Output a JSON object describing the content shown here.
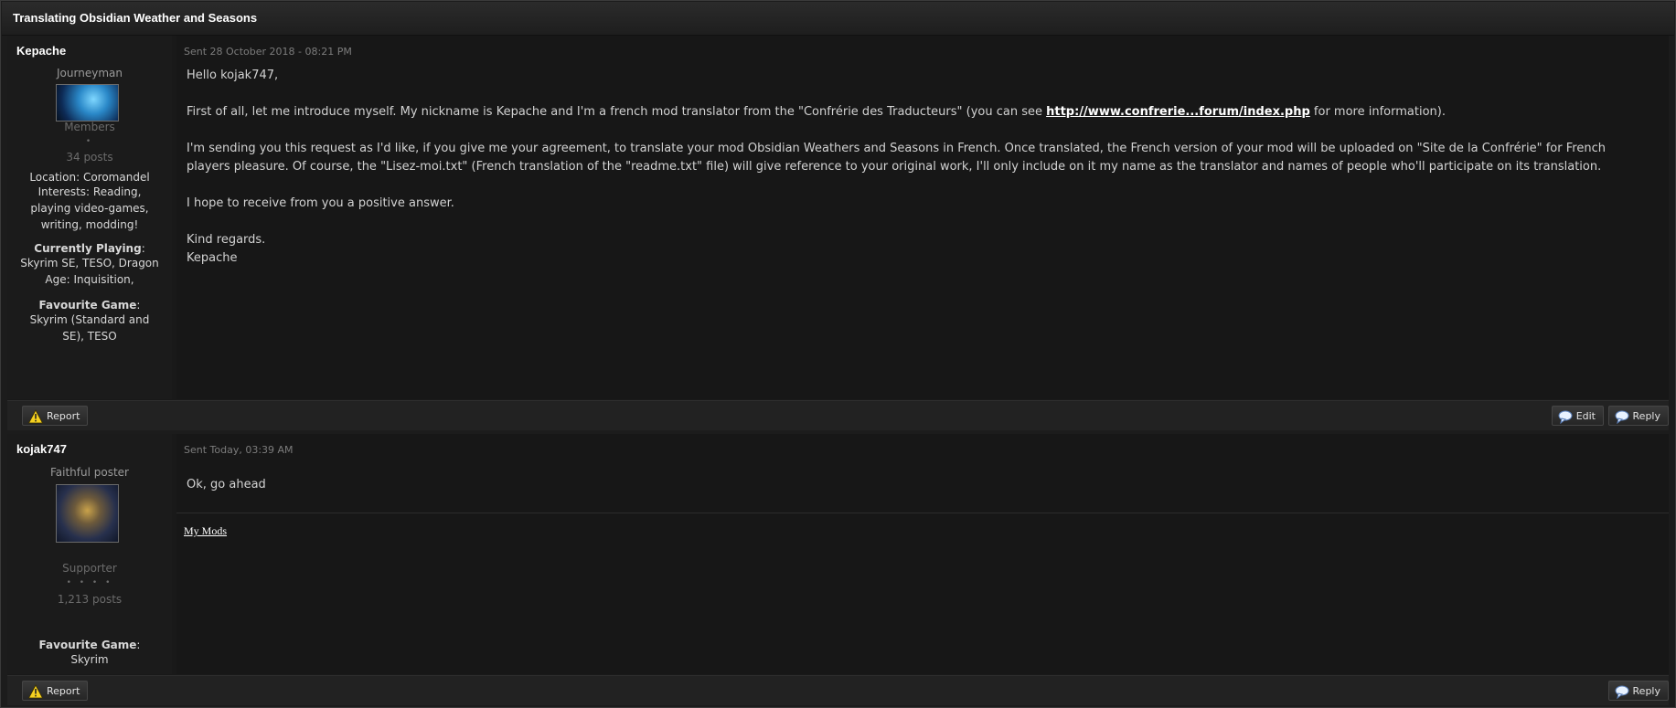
{
  "topic": {
    "title": "Translating Obsidian Weather and Seasons"
  },
  "posts": [
    {
      "author": "Kepache",
      "rank": "Journeyman",
      "group": "Members",
      "pips": "•",
      "post_count": "34 posts",
      "location": "Location: Coromandel",
      "interests": "Interests: Reading, playing video-games, writing, modding!",
      "currently_playing_label": "Currently Playing",
      "currently_playing": "Skyrim SE, TESO, Dragon Age: Inquisition,",
      "favourite_game_label": "Favourite Game",
      "favourite_game": "Skyrim (Standard and SE), TESO",
      "date": "Sent 28 October 2018 - 08:21 PM",
      "greeting": "Hello kojak747,",
      "para1_before": "First of all, let me introduce myself. My nickname is Kepache and I'm a french mod translator from the \"Confrérie des Traducteurs\" (you can see ",
      "para1_link": "http://www.confrerie...forum/index.php",
      "para1_after": " for more information).",
      "para2": "I'm sending you this request as I'd like, if you give me your agreement, to translate your mod Obsidian Weathers and Seasons in French. Once translated, the French version of your mod will be uploaded on \"Site de la Confrérie\" for French players pleasure. Of course, the \"Lisez-moi.txt\" (French translation of the \"readme.txt\" file) will give reference to your original work, I'll only include on it my name as the translator and names of people who'll participate on its translation.",
      "para3": "I hope to receive from you a positive answer.",
      "closing": "Kind regards.",
      "signature_name": "Kepache",
      "report_label": "Report",
      "edit_label": "Edit",
      "reply_label": "Reply"
    },
    {
      "author": "kojak747",
      "rank": "Faithful poster",
      "group": "Supporter",
      "pips": "• • • •",
      "post_count": "1,213 posts",
      "favourite_game_label": "Favourite Game",
      "favourite_game": "Skyrim",
      "date": "Sent Today, 03:39 AM",
      "message": "Ok, go ahead",
      "sig_link": "My Mods",
      "report_label": "Report",
      "reply_label": "Reply"
    }
  ],
  "icons": {
    "report": "warning-triangle-icon",
    "edit": "speech-bubble-icon",
    "reply": "speech-bubble-icon"
  },
  "colors": {
    "background": "#1a1a1a",
    "text": "#c8c8c8",
    "link": "#ffffff",
    "warning": "#f5d020"
  }
}
